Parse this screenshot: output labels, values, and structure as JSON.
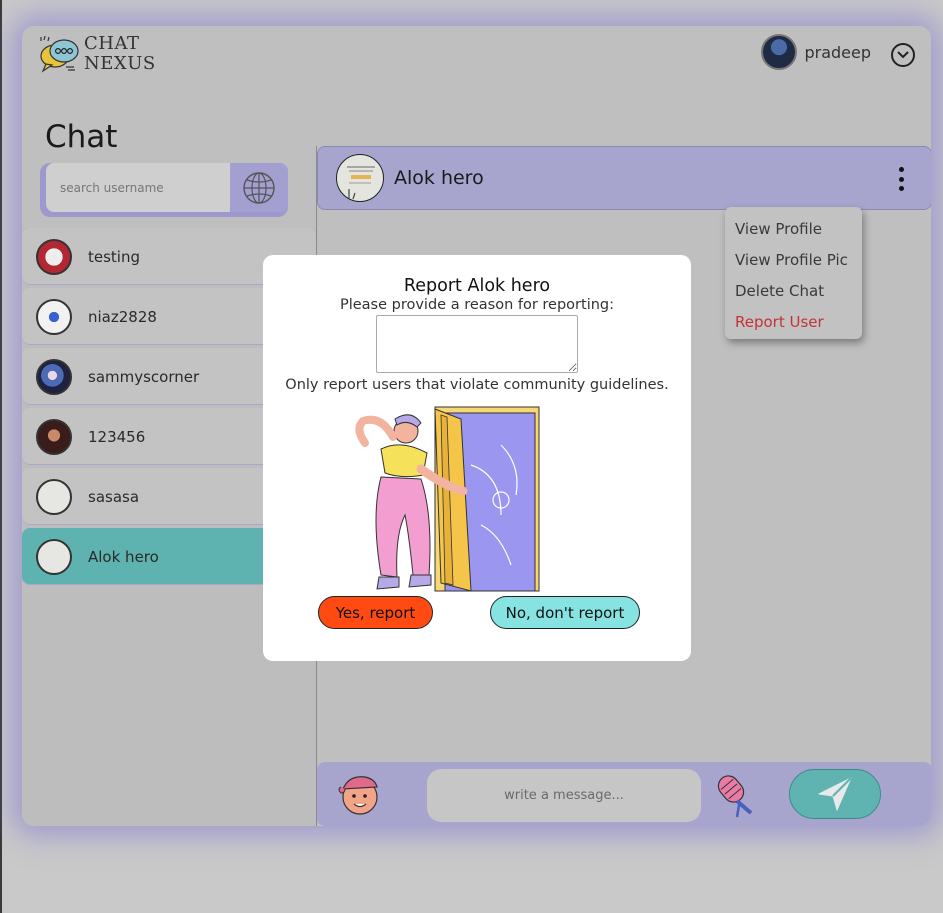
{
  "app": {
    "logo_line1": "CHAT",
    "logo_line2": "NEXUS"
  },
  "header": {
    "username": "pradeep"
  },
  "sidebar": {
    "title": "Chat",
    "search_placeholder": "search username",
    "chats": [
      {
        "name": "testing",
        "avatar_icon": "die-glocke-avatar",
        "active": false
      },
      {
        "name": "niaz2828",
        "avatar_icon": "focus-logo-avatar",
        "active": false
      },
      {
        "name": "sammyscorner",
        "avatar_icon": "anime-avatar",
        "active": false
      },
      {
        "name": "123456",
        "avatar_icon": "portrait-avatar",
        "active": false
      },
      {
        "name": "sasasa",
        "avatar_icon": "text-image-avatar",
        "active": false
      },
      {
        "name": "Alok hero",
        "avatar_icon": "text-image-avatar",
        "active": true
      }
    ]
  },
  "chat": {
    "contact_name": "Alok hero",
    "menu": {
      "view_profile": "View Profile",
      "view_profile_pic": "View Profile Pic",
      "delete_chat": "Delete Chat",
      "report_user": "Report User"
    },
    "message_placeholder": "write a message..."
  },
  "modal": {
    "title": "Report Alok hero",
    "prompt": "Please provide a reason for reporting:",
    "reason_value": "",
    "note": "Only report users that violate community guidelines.",
    "yes_label": "Yes, report",
    "no_label": "No, don't report"
  },
  "colors": {
    "accent_purple": "#a7a4ce",
    "accent_teal": "#5eb3b0",
    "report_red": "#ff4a12",
    "cancel_cyan": "#86e3e2",
    "danger_text": "#c4323a"
  }
}
